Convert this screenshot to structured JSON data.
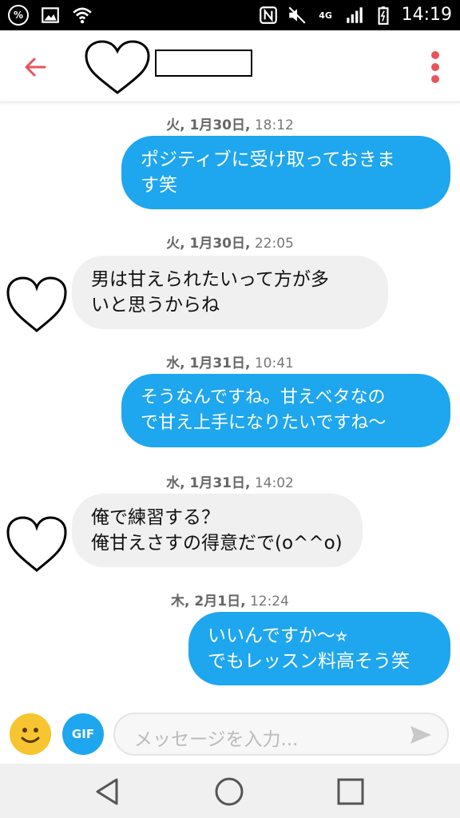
{
  "status_bar": {
    "time": "14:19",
    "icons": [
      "percent-icon",
      "image-icon",
      "wifi-icon",
      "nfc-icon",
      "mute-icon",
      "lte-4g-icon",
      "signal-icon",
      "battery-icon"
    ],
    "network_label": "4G"
  },
  "header": {
    "back_icon": "arrow-left-icon",
    "avatar_icon": "heart-outline-icon",
    "more_icon": "more-vertical-icon",
    "accent_color": "#e8545b"
  },
  "messages": [
    {
      "timestamp_day": "火, 1月30日,",
      "timestamp_time": " 18:12",
      "direction": "out",
      "text": "ポジティブに受け取っておきま\nす笑"
    },
    {
      "timestamp_day": "火, 1月30日,",
      "timestamp_time": " 22:05",
      "direction": "in",
      "text": "男は甘えられたいって方が多\nいと思うからね"
    },
    {
      "timestamp_day": "水, 1月31日,",
      "timestamp_time": " 10:41",
      "direction": "out",
      "text": "そうなんですね。甘えベタなの\nで甘え上手になりたいですね〜"
    },
    {
      "timestamp_day": "水, 1月31日,",
      "timestamp_time": " 14:02",
      "direction": "in",
      "text": "俺で練習する？\n俺甘えさすの得意だで(o^^o)"
    },
    {
      "timestamp_day": "木, 2月1日,",
      "timestamp_time": " 12:24",
      "direction": "out",
      "text": "いいんですか〜⭐︎\nでもレッスン料高そう笑"
    }
  ],
  "composer": {
    "emoji_icon": "smiley-icon",
    "gif_label": "GIF",
    "placeholder": "メッセージを入力...",
    "send_icon": "send-icon"
  },
  "nav": {
    "back": "triangle-back-icon",
    "home": "circle-home-icon",
    "recents": "square-recents-icon"
  },
  "colors": {
    "outgoing_bubble": "#1ea6ee",
    "incoming_bubble": "#f0f0f0",
    "accent": "#e8545b"
  }
}
